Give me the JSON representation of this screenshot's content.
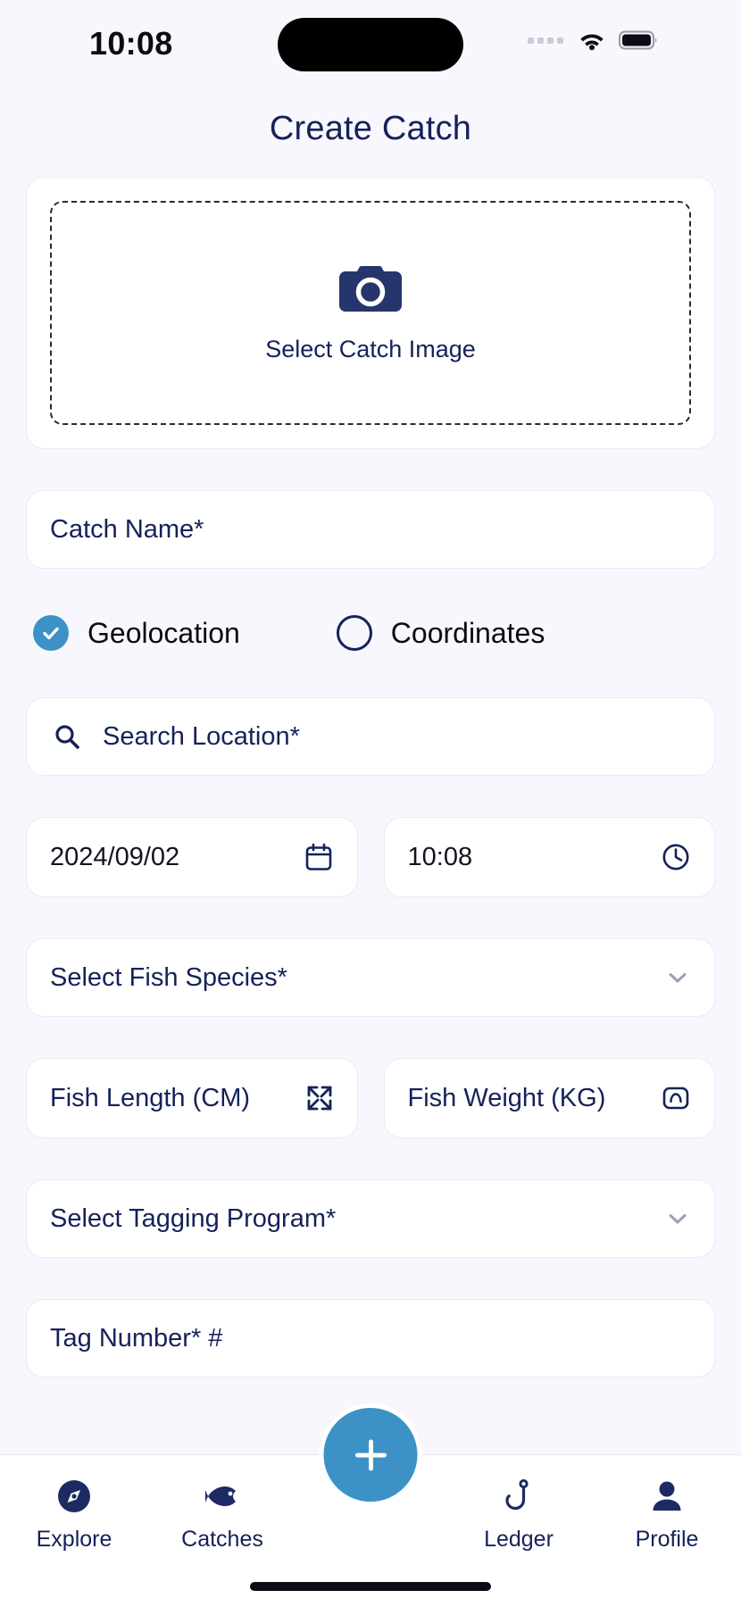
{
  "status_bar": {
    "time": "10:08",
    "icons": [
      "signal-dots-icon",
      "wifi-icon",
      "battery-icon"
    ]
  },
  "header": {
    "title": "Create Catch"
  },
  "colors": {
    "background": "#f7f7fd",
    "card": "#ffffff",
    "navy": "#152259",
    "accent": "#3c92c6",
    "border": "#e3eef3"
  },
  "image_picker": {
    "icon": "camera-icon",
    "label": "Select Catch Image"
  },
  "form": {
    "catch_name": {
      "placeholder": "Catch Name*",
      "value": ""
    },
    "location_mode": {
      "selected": "Geolocation",
      "options": [
        {
          "label": "Geolocation",
          "checked": true
        },
        {
          "label": "Coordinates",
          "checked": false
        }
      ]
    },
    "search_location": {
      "icon": "search-icon",
      "placeholder": "Search Location*",
      "value": ""
    },
    "date": {
      "value": "2024/09/02",
      "icon": "calendar-icon"
    },
    "time": {
      "value": "10:08",
      "icon": "clock-icon"
    },
    "fish_species": {
      "placeholder": "Select Fish Species*",
      "icon": "chevron-down-icon"
    },
    "fish_length": {
      "placeholder": "Fish Length (CM)",
      "icon": "expand-arrows-icon",
      "value": ""
    },
    "fish_weight": {
      "placeholder": "Fish Weight (KG)",
      "icon": "scale-icon",
      "value": ""
    },
    "tagging_program": {
      "placeholder": "Select Tagging Program*",
      "icon": "chevron-down-icon"
    },
    "tag_number": {
      "placeholder": "Tag Number* #",
      "value": ""
    }
  },
  "bottom_nav": {
    "items": [
      {
        "label": "Explore",
        "icon": "compass-icon"
      },
      {
        "label": "Catches",
        "icon": "fish-icon"
      },
      {
        "label": "Ledger",
        "icon": "fish-hook-icon"
      },
      {
        "label": "Profile",
        "icon": "person-icon"
      }
    ],
    "fab": {
      "icon": "plus-icon",
      "label": "+"
    }
  }
}
